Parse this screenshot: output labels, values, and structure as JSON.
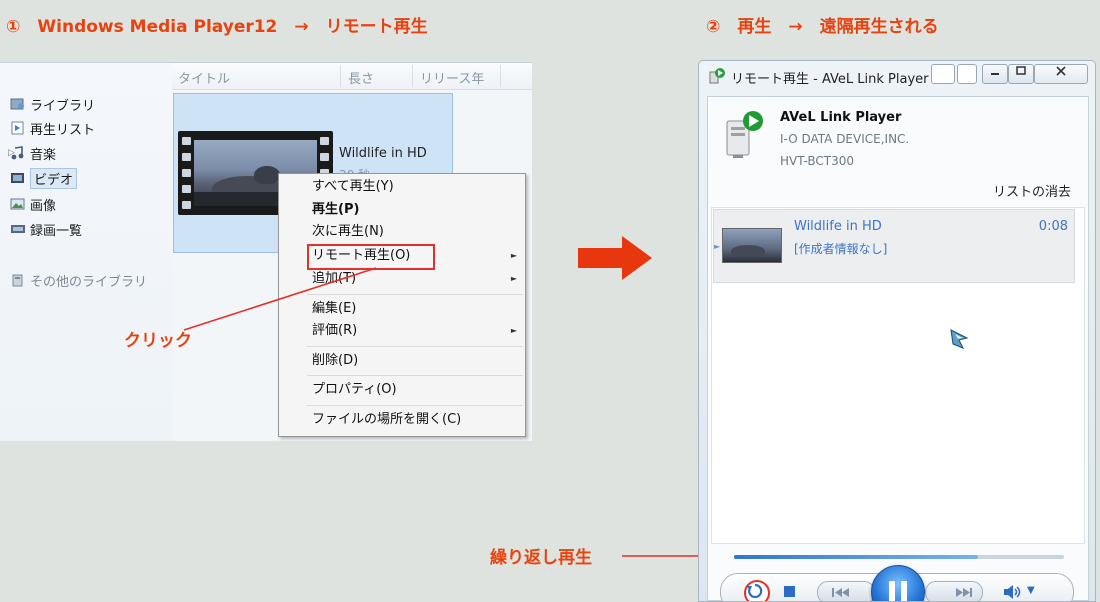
{
  "headings": {
    "step1": "①　Windows Media Player12　→　リモート再生",
    "step2": "②　再生　→　遠隔再生される"
  },
  "wmp": {
    "columns": [
      "タイトル",
      "長さ",
      "リリース年"
    ],
    "sidebar": [
      {
        "label": "ライブラリ",
        "icon": "library-icon"
      },
      {
        "label": "再生リスト",
        "icon": "playlist-icon"
      },
      {
        "label": "音楽",
        "icon": "music-icon"
      },
      {
        "label": "ビデオ",
        "icon": "video-icon",
        "selected": true
      },
      {
        "label": "画像",
        "icon": "picture-icon"
      },
      {
        "label": "録画一覧",
        "icon": "recorded-tv-icon"
      }
    ],
    "other_library": "その他のライブラリ",
    "media_item": {
      "title": "Wildlife in HD",
      "duration": "30 秒"
    },
    "context_menu": {
      "play_all": "すべて再生(Y)",
      "play": "再生(P)",
      "play_next": "次に再生(N)",
      "remote_play": "リモート再生(O)",
      "add_to": "追加(T)",
      "edit": "編集(E)",
      "rate": "評価(R)",
      "delete": "削除(D)",
      "properties": "プロパティ(O)",
      "open_location": "ファイルの場所を開く(C)"
    }
  },
  "annotations": {
    "click": "クリック",
    "repeat_play": "繰り返し再生"
  },
  "player": {
    "window_title": "リモート再生 - AVeL Link Player",
    "device_name": "AVeL Link Player",
    "device_maker": "I-O DATA DEVICE,INC.",
    "device_model": "HVT-BCT300",
    "clear_list": "リストの消去",
    "track": {
      "title": "Wildlife in HD",
      "artist": "[作成者情報なし]",
      "time": "0:08"
    },
    "seek_progress": 0.74
  },
  "colors": {
    "accent": "#e8420f",
    "highlight_box": "#e3302b",
    "link_blue": "#3d74c8"
  }
}
